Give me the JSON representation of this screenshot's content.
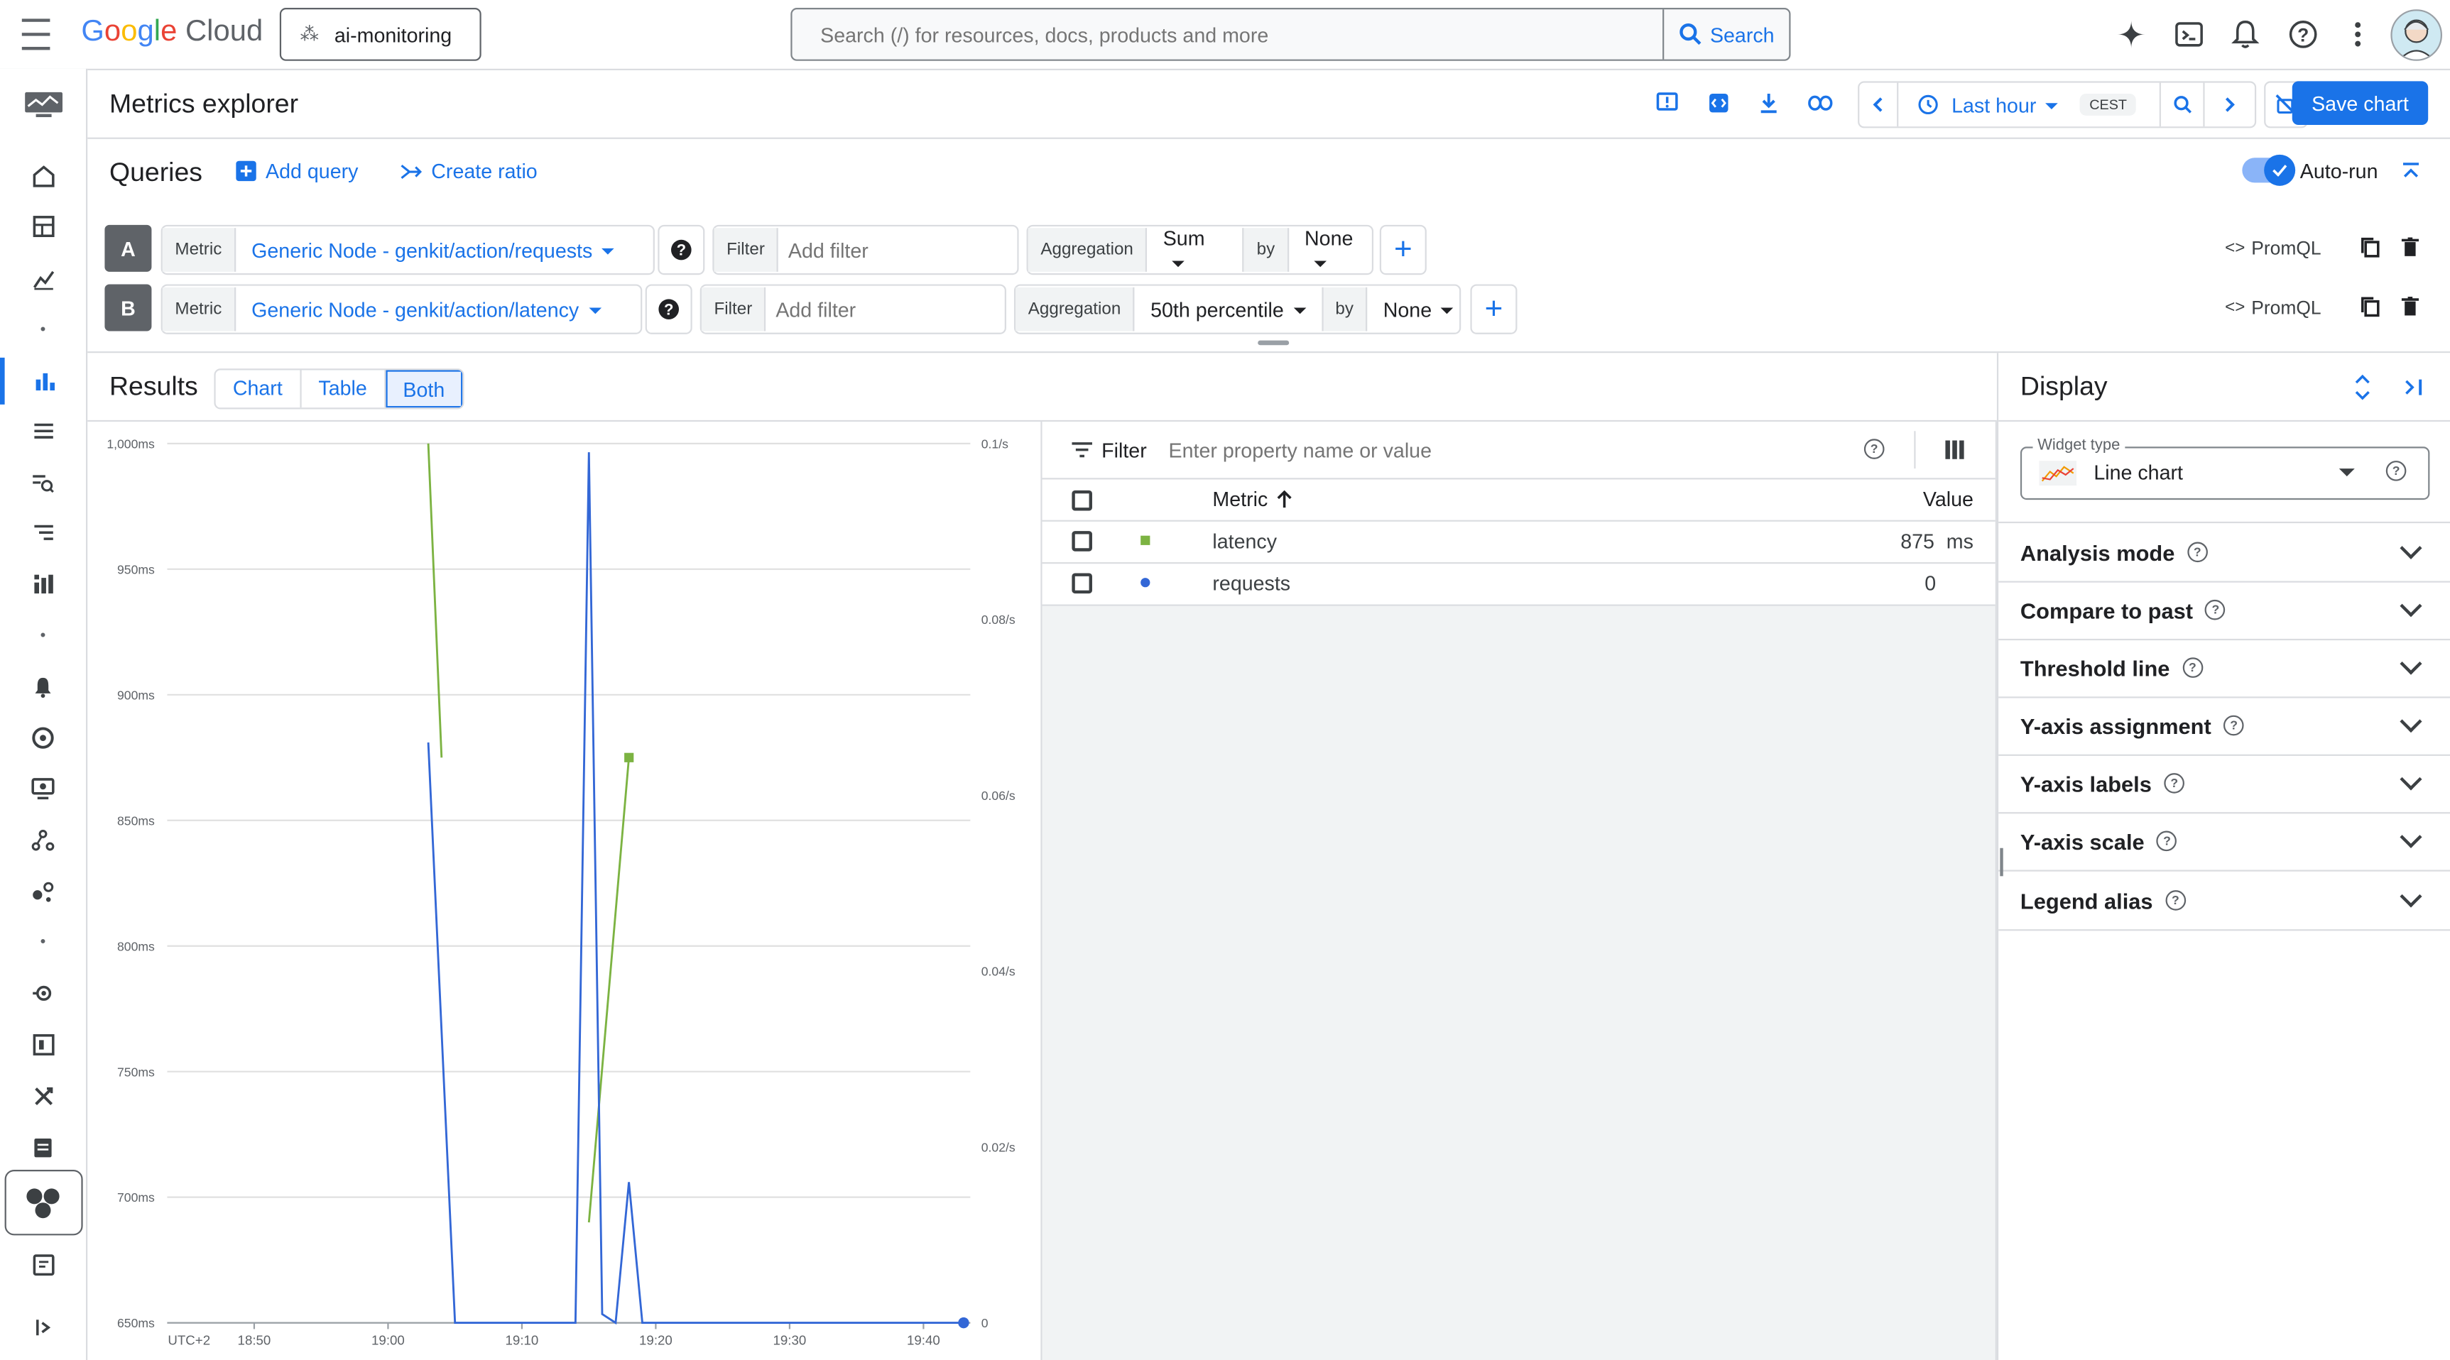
{
  "top": {
    "logo_text": "Google Cloud",
    "project": "ai-monitoring",
    "search_placeholder": "Search (/) for resources, docs, products and more",
    "search_button": "Search"
  },
  "header": {
    "title": "Metrics explorer",
    "time_range": "Last hour",
    "timezone": "CEST",
    "save_chart": "Save chart"
  },
  "queries": {
    "title": "Queries",
    "add_query": "Add query",
    "create_ratio": "Create ratio",
    "auto_run": "Auto-run",
    "rows": [
      {
        "letter": "A",
        "metric_label": "Metric",
        "metric": "Generic Node - genkit/action/requests",
        "filter_label": "Filter",
        "filter_placeholder": "Add filter",
        "aggregation_label": "Aggregation",
        "aggregation": "Sum",
        "by": "by",
        "group_by": "None",
        "promql": "PromQL"
      },
      {
        "letter": "B",
        "metric_label": "Metric",
        "metric": "Generic Node - genkit/action/latency",
        "filter_label": "Filter",
        "filter_placeholder": "Add filter",
        "aggregation_label": "Aggregation",
        "aggregation": "50th percentile",
        "by": "by",
        "group_by": "None",
        "promql": "PromQL"
      }
    ]
  },
  "results": {
    "title": "Results",
    "tabs": [
      "Chart",
      "Table",
      "Both"
    ],
    "active_tab": "Both"
  },
  "chart_data": {
    "type": "line",
    "x_ticks": [
      "UTC+2",
      "18:50",
      "19:00",
      "19:10",
      "19:20",
      "19:30",
      "19:40"
    ],
    "y_left_ticks": [
      "1,000ms",
      "950ms",
      "900ms",
      "850ms",
      "800ms",
      "750ms",
      "700ms",
      "650ms"
    ],
    "y_left_lim": [
      650,
      1000
    ],
    "y_right_ticks": [
      "0.1/s",
      "0.08/s",
      "0.06/s",
      "0.04/s",
      "0.02/s",
      "0"
    ],
    "y_right_lim": [
      0,
      0.1
    ],
    "series": [
      {
        "name": "latency",
        "axis": "left",
        "color": "#7cb342",
        "segments": [
          [
            {
              "t": "19:03",
              "v": 1000
            },
            {
              "t": "19:04",
              "v": 875
            }
          ],
          [
            {
              "t": "19:15",
              "v": 690
            },
            {
              "t": "19:18",
              "v": 875
            }
          ]
        ]
      },
      {
        "name": "requests",
        "axis": "right",
        "color": "#3367d6",
        "points": [
          {
            "t": "19:03",
            "v": 0.066
          },
          {
            "t": "19:05",
            "v": 0
          },
          {
            "t": "19:06",
            "v": 0
          },
          {
            "t": "19:14",
            "v": 0
          },
          {
            "t": "19:15",
            "v": 0.099
          },
          {
            "t": "19:16",
            "v": 0.001
          },
          {
            "t": "19:17",
            "v": 0
          },
          {
            "t": "19:18",
            "v": 0.016
          },
          {
            "t": "19:19",
            "v": 0
          },
          {
            "t": "19:43",
            "v": 0
          }
        ]
      }
    ]
  },
  "table": {
    "filter_label": "Filter",
    "filter_placeholder": "Enter property name or value",
    "col_metric": "Metric",
    "col_value": "Value",
    "rows": [
      {
        "name": "latency",
        "value": "875",
        "unit": "ms",
        "color": "#7cb342"
      },
      {
        "name": "requests",
        "value": "0",
        "unit": "",
        "color": "#3367d6"
      }
    ]
  },
  "display": {
    "title": "Display",
    "widget_type_label": "Widget type",
    "widget_type": "Line chart",
    "sections": [
      "Analysis mode",
      "Compare to past",
      "Threshold line",
      "Y-axis assignment",
      "Y-axis labels",
      "Y-axis scale",
      "Legend alias"
    ]
  }
}
